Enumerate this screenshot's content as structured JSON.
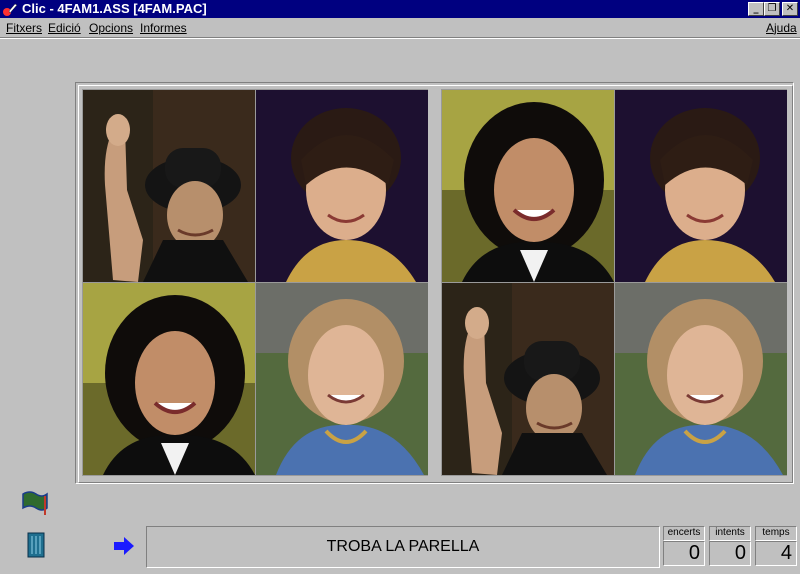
{
  "window": {
    "title": "Clic - 4FAM1.ASS [4FAM.PAC]"
  },
  "window_buttons": {
    "minimize": "_",
    "restore": "❐",
    "close": "✕"
  },
  "menu": {
    "items": [
      "Fitxers",
      "Edició",
      "Opcions",
      "Informes"
    ],
    "help": "Ajuda"
  },
  "board": {
    "left_cards": [
      "woman-waving-black-hat",
      "woman-short-brown-hair",
      "woman-dark-hair-smiling",
      "woman-light-hair-blue-jacket"
    ],
    "right_cards": [
      "woman-dark-hair-smiling",
      "woman-short-brown-hair",
      "woman-waving-black-hat",
      "woman-light-hair-blue-jacket"
    ]
  },
  "status": {
    "message": "TROBA LA PARELLA",
    "counters": [
      {
        "label": "encerts",
        "value": "0"
      },
      {
        "label": "intents",
        "value": "0"
      },
      {
        "label": "temps",
        "value": "4"
      }
    ]
  },
  "colors": {
    "title_bar": "#000080",
    "background": "#c0c0c0",
    "arrow": "#1a1aff"
  },
  "icons": {
    "flag": "flag-icon",
    "door": "door-icon",
    "arrow": "arrow-right-icon"
  }
}
